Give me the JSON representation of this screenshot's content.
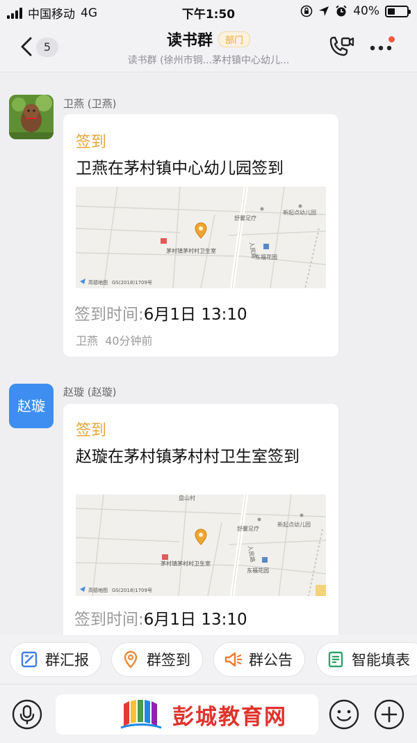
{
  "status_bar": {
    "carrier": "中国移动",
    "network": "4G",
    "time": "下午1:50",
    "battery_percent": "40%",
    "battery_level": 0.4
  },
  "header": {
    "unread_count": "5",
    "title": "读书群",
    "badge": "部门",
    "subtitle": "读书群 (徐州市铜...茅村镇中心幼儿...",
    "icons": [
      "back-chevron-icon",
      "video-call-icon",
      "more-icon"
    ]
  },
  "messages": [
    {
      "sender": "卫燕 (卫燕)",
      "avatar_type": "photo",
      "card_type": "签到",
      "text": "卫燕在茅村镇中心幼儿园签到",
      "map": {
        "labels": [
          "舒馨足疗",
          "新起点幼儿园",
          "人民路",
          "茅村镇茅村村卫生室",
          "东福花园",
          "GS(2018)1709号"
        ]
      },
      "time_label": "签到时间:",
      "time_value": "6月1日 13:10",
      "footer_name": "卫燕",
      "footer_ago": "40分钟前"
    },
    {
      "sender": "赵璇 (赵璇)",
      "avatar_type": "text",
      "avatar_text": "赵璇",
      "card_type": "签到",
      "text": "赵璇在茅村镇茅村村卫生室签到",
      "map": {
        "labels": [
          "盘山村",
          "舒馨足疗",
          "新起点幼儿园",
          "人民路",
          "茅村镇茅村村卫生室",
          "东福花园",
          "GS(2018)1709号"
        ]
      },
      "time_label": "签到时间:",
      "time_value": "6月1日 13:10"
    }
  ],
  "shortcuts": [
    {
      "label": "群汇报",
      "icon": "report-icon"
    },
    {
      "label": "群签到",
      "icon": "location-pin-icon"
    },
    {
      "label": "群公告",
      "icon": "megaphone-icon"
    },
    {
      "label": "智能填表",
      "icon": "form-icon"
    }
  ],
  "input_bar": {
    "voice_icon": "microphone-icon",
    "emoji_icon": "emoji-icon",
    "add_icon": "plus-icon",
    "watermark_text": "彭城教育网"
  },
  "colors": {
    "accent_orange": "#e7a53c",
    "blue_avatar": "#3d8ef0",
    "watermark_red": "#e0332c",
    "background": "#efeff2"
  }
}
